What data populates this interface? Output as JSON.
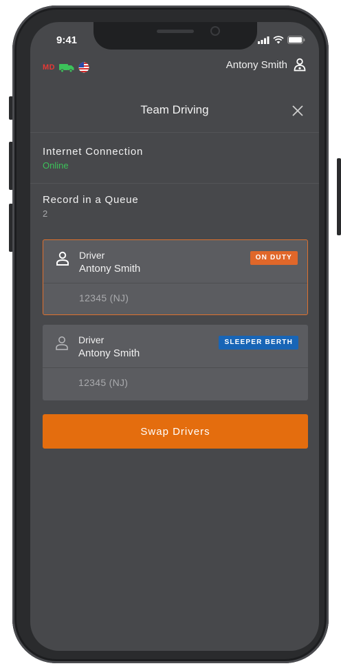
{
  "status_bar": {
    "time": "9:41"
  },
  "app_bar": {
    "region": "MD",
    "user_name": "Antony Smith"
  },
  "header": {
    "title": "Team Driving"
  },
  "internet": {
    "label": "Internet Connection",
    "value": "Online"
  },
  "queue": {
    "label": "Record in a Queue",
    "value": "2"
  },
  "drivers": [
    {
      "role": "Driver",
      "name": "Antony Smith",
      "status": "ON DUTY",
      "license": "12345 (NJ)"
    },
    {
      "role": "Driver",
      "name": "Antony Smith",
      "status": "SLEEPER BERTH",
      "license": "12345 (NJ)"
    }
  ],
  "actions": {
    "swap_label": "Swap Drivers"
  },
  "colors": {
    "online": "#3cc25a",
    "on_duty": "#e0672a",
    "sleeper_berth": "#1865b6",
    "primary_button": "#e46d0e"
  }
}
